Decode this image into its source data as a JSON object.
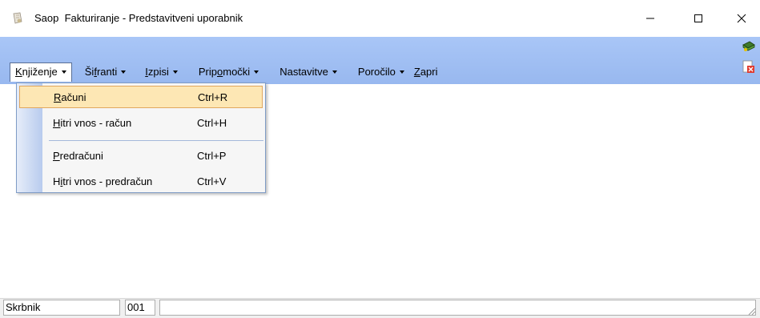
{
  "window": {
    "title": "Saop  Fakturiranje - Predstavitveni uporabnik",
    "icon": "saop-app-icon",
    "controls": [
      "minimize-icon",
      "maximize-icon",
      "close-icon"
    ]
  },
  "menubar": {
    "items": [
      {
        "label": "Knjiženje",
        "mnemonic_index": 0,
        "has_caret": true,
        "active": true
      },
      {
        "label": "Šifranti",
        "mnemonic_index": 2,
        "has_caret": true
      },
      {
        "label": "Izpisi",
        "mnemonic_index": 0,
        "has_caret": true
      },
      {
        "label": "Pripomočki",
        "mnemonic_index": 4,
        "has_caret": true
      },
      {
        "label": "Nastavitve",
        "mnemonic_index": -1,
        "has_caret": true
      },
      {
        "label": "Poročilo",
        "mnemonic_index": -1,
        "has_caret": true
      },
      {
        "label": "Zapri",
        "mnemonic_index": 0,
        "has_caret": false
      }
    ]
  },
  "toolbar_right_icons": [
    "book-icon",
    "close-document-icon"
  ],
  "dropdown": {
    "items": [
      {
        "label": "Računi",
        "mnemonic_index": 0,
        "shortcut": "Ctrl+R",
        "highlighted": true
      },
      {
        "label": "Hitri vnos - račun",
        "mnemonic_index": 0,
        "shortcut": "Ctrl+H"
      },
      {
        "label": "Predračuni",
        "mnemonic_index": 0,
        "shortcut": "Ctrl+P"
      },
      {
        "label": "Hitri vnos - predračun",
        "mnemonic_index": 1,
        "shortcut": "Ctrl+V"
      }
    ]
  },
  "statusbar": {
    "user": "Skrbnik",
    "code": "001",
    "message": ""
  },
  "colors": {
    "toolbar_band": "#a9c6f7",
    "highlight_fill": "#fde7b4",
    "highlight_border": "#e0a75e"
  }
}
